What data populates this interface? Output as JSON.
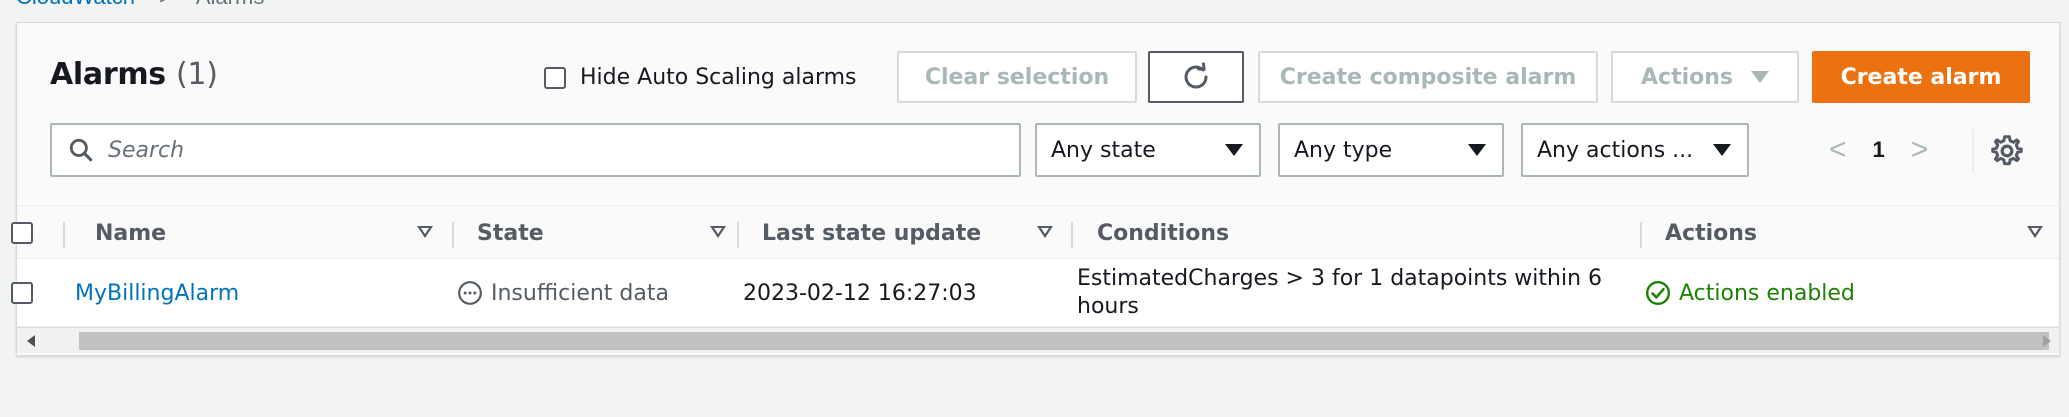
{
  "breadcrumb": {
    "parent": "CloudWatch",
    "separator": ">",
    "current": "Alarms"
  },
  "header": {
    "title": "Alarms",
    "count": "(1)",
    "hide_autoscaling_label": "Hide Auto Scaling alarms",
    "hide_autoscaling_checked": false,
    "clear_selection_label": "Clear selection",
    "refresh_icon": "refresh-icon",
    "create_composite_label": "Create composite alarm",
    "actions_label": "Actions",
    "create_alarm_label": "Create alarm"
  },
  "filters": {
    "search_placeholder": "Search",
    "state_value": "Any state",
    "type_value": "Any type",
    "actions_value": "Any actions ..."
  },
  "pagination": {
    "current_page": "1",
    "prev": "<",
    "next": ">"
  },
  "table": {
    "columns": {
      "name": "Name",
      "state": "State",
      "last_update": "Last state update",
      "conditions": "Conditions",
      "actions": "Actions"
    },
    "rows": [
      {
        "name": "MyBillingAlarm",
        "state": "Insufficient data",
        "last_update": "2023-02-12 16:27:03",
        "conditions": "EstimatedCharges > 3 for 1 datapoints within 6 hours",
        "actions": "Actions enabled"
      }
    ]
  },
  "colors": {
    "primary_orange": "#ec7211",
    "link_blue": "#0073bb",
    "success_green": "#1d8102"
  }
}
